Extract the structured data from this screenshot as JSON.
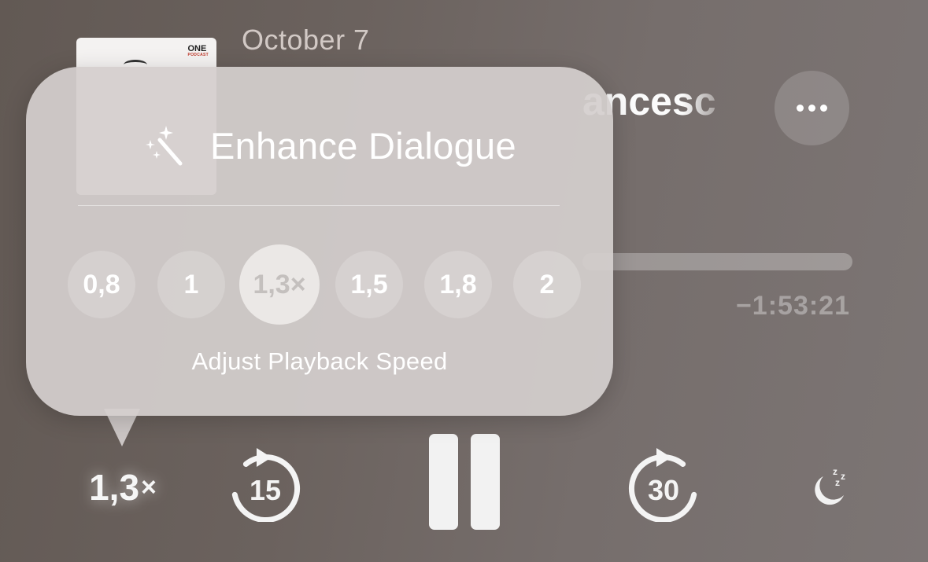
{
  "episode": {
    "date": "October 7",
    "title_fragment": "ancesc",
    "artwork_logo": "ONE",
    "artwork_logo_sub": "PODCAST",
    "remaining_time": "−1:53:21",
    "progress_fraction": 0.0
  },
  "controls": {
    "speed_value": "1,3",
    "speed_suffix": "×",
    "skip_back_seconds": "15",
    "skip_forward_seconds": "30",
    "more_icon": "ellipsis-icon",
    "sleep_icon": "moon-zzz-icon",
    "pause_icon": "pause-icon"
  },
  "popover": {
    "enhance_label": "Enhance Dialogue",
    "enhance_icon": "magic-wand-icon",
    "speed_options": [
      "0,8",
      "1",
      "1,3×",
      "1,5",
      "1,8",
      "2"
    ],
    "selected_speed_index": 2,
    "speed_caption": "Adjust Playback Speed"
  },
  "colors": {
    "background": "#6b625e",
    "popover": "#d4cfcd",
    "selected_option": "#ebe8e6",
    "date_text": "#d2c9c5"
  }
}
